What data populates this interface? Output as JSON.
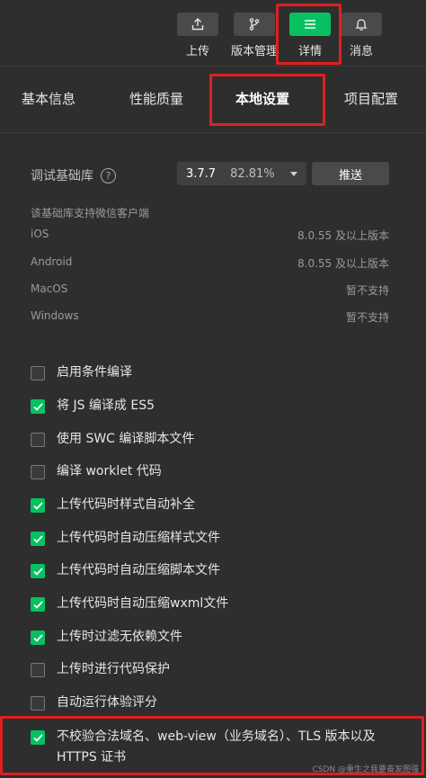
{
  "toolbar": {
    "upload": {
      "label": "上传",
      "icon": "upload-icon"
    },
    "version": {
      "label": "版本管理",
      "icon": "branch-icon"
    },
    "details": {
      "label": "详情",
      "icon": "menu-icon"
    },
    "messages": {
      "label": "消息",
      "icon": "bell-icon"
    }
  },
  "tabs": [
    {
      "label": "基本信息"
    },
    {
      "label": "性能质量"
    },
    {
      "label": "本地设置"
    },
    {
      "label": "项目配置"
    }
  ],
  "baselib": {
    "label": "调试基础库",
    "version": "3.7.7",
    "coverage": "82.81%",
    "push_label": "推送"
  },
  "support": {
    "caption": "该基础库支持微信客户端",
    "rows": [
      {
        "platform": "iOS",
        "value": "8.0.55 及以上版本"
      },
      {
        "platform": "Android",
        "value": "8.0.55 及以上版本"
      },
      {
        "platform": "MacOS",
        "value": "暂不支持"
      },
      {
        "platform": "Windows",
        "value": "暂不支持"
      }
    ]
  },
  "options": [
    {
      "label": "启用条件编译",
      "checked": false
    },
    {
      "label": "将 JS 编译成 ES5",
      "checked": true
    },
    {
      "label": "使用 SWC 编译脚本文件",
      "checked": false
    },
    {
      "label": "编译 worklet 代码",
      "checked": false
    },
    {
      "label": "上传代码时样式自动补全",
      "checked": true
    },
    {
      "label": "上传代码时自动压缩样式文件",
      "checked": true
    },
    {
      "label": "上传代码时自动压缩脚本文件",
      "checked": true
    },
    {
      "label": "上传代码时自动压缩wxml文件",
      "checked": true
    },
    {
      "label": "上传时过滤无依赖文件",
      "checked": true
    },
    {
      "label": "上传时进行代码保护",
      "checked": false
    },
    {
      "label": "自动运行体验评分",
      "checked": false
    },
    {
      "label": "不校验合法域名、web-view（业务域名）、TLS 版本以及 HTTPS 证书",
      "checked": true
    }
  ],
  "watermark": "CSDN @重生之我要奋发图强",
  "colors": {
    "accent": "#07c160",
    "highlight": "#e02020",
    "background": "#2e2e2e"
  }
}
